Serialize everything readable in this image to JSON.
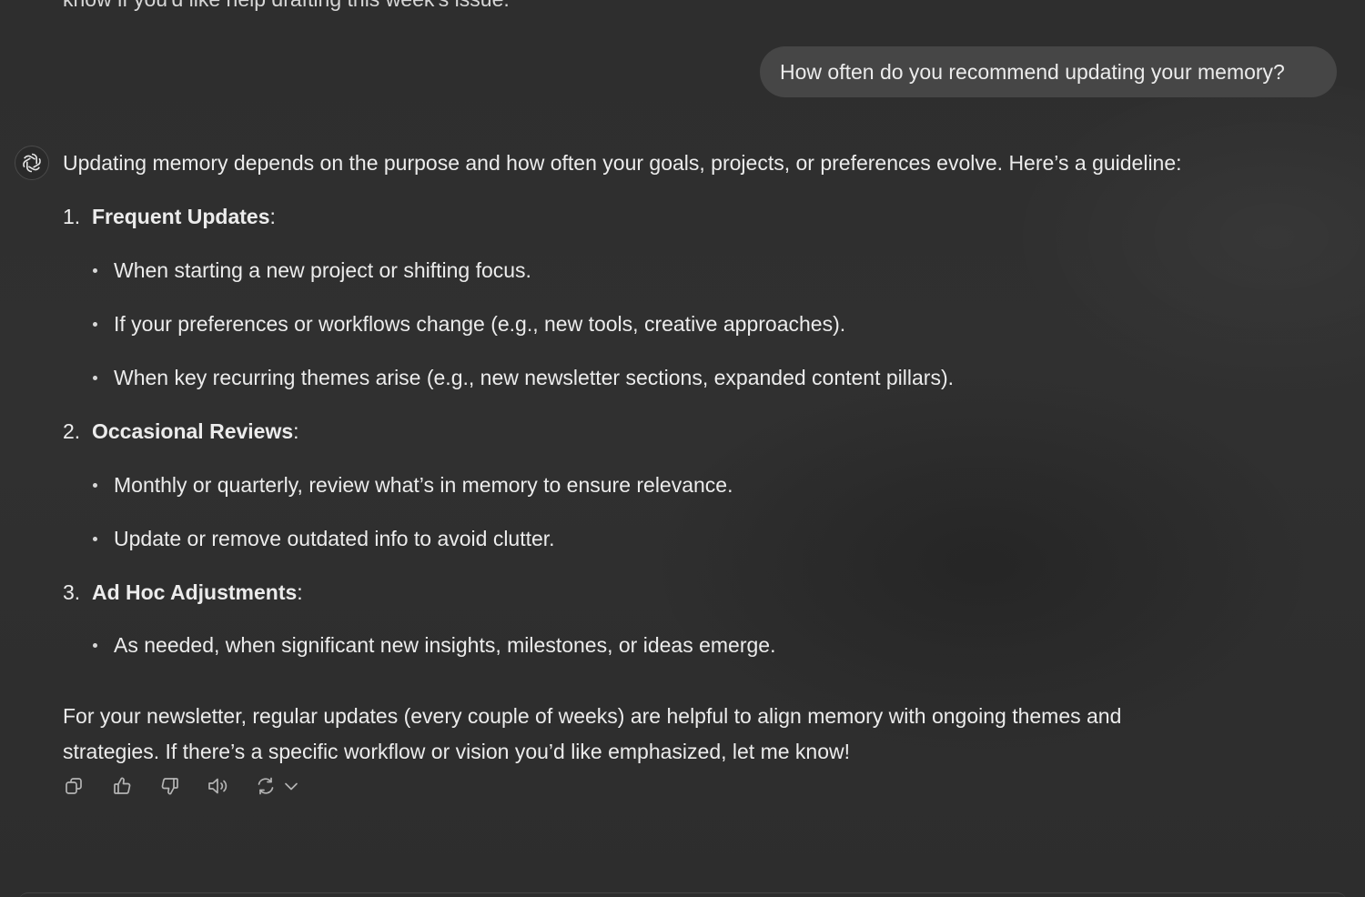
{
  "previous_message_fragment": "know if you'd like help drafting this week's issue.",
  "user_message": "How often do you recommend updating your memory?",
  "assistant": {
    "intro": "Updating memory depends on the purpose and how often your goals, projects, or preferences evolve. Here’s a guideline:",
    "sections": [
      {
        "number": "1.",
        "title": "Frequent Updates",
        "colon": ":",
        "items": [
          "When starting a new project or shifting focus.",
          "If your preferences or workflows change (e.g., new tools, creative approaches).",
          "When key recurring themes arise (e.g., new newsletter sections, expanded content pillars)."
        ]
      },
      {
        "number": "2.",
        "title": "Occasional Reviews",
        "colon": ":",
        "items": [
          "Monthly or quarterly, review what’s in memory to ensure relevance.",
          "Update or remove outdated info to avoid clutter."
        ]
      },
      {
        "number": "3.",
        "title": "Ad Hoc Adjustments",
        "colon": ":",
        "items": [
          "As needed, when significant new insights, milestones, or ideas emerge."
        ]
      }
    ],
    "closing_line1": "For your newsletter, regular updates (every couple of weeks) are helpful to align memory with ongoing themes and",
    "closing_line2": "strategies. If there’s a specific workflow or vision you’d like emphasized, let me know!"
  },
  "action_icons": [
    "copy-icon",
    "thumbs-up-icon",
    "thumbs-down-icon",
    "read-aloud-icon",
    "regenerate-icon",
    "chevron-down-icon"
  ],
  "colors": {
    "background": "#2f2f2f",
    "user_bubble": "#464646",
    "text": "#ececec"
  }
}
